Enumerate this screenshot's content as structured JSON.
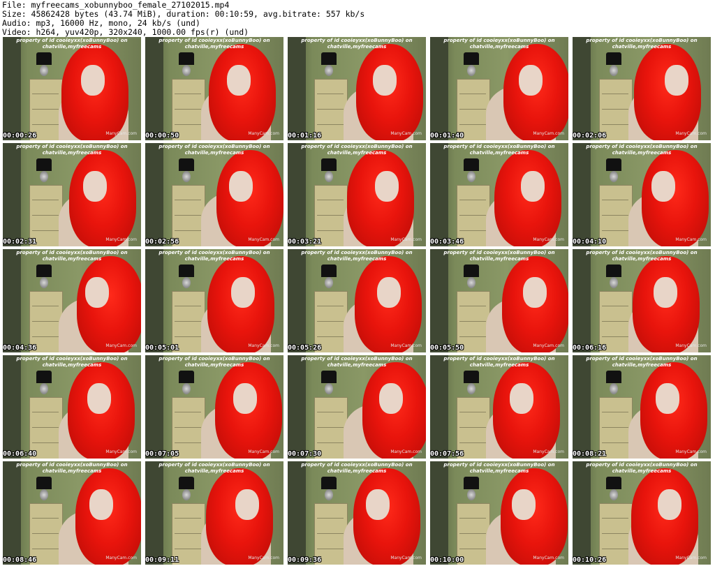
{
  "header": {
    "file": "File: myfreecams_xobunnyboo_female_27102015.mp4",
    "size": "Size: 45862428 bytes (43.74 MiB), duration: 00:10:59, avg.bitrate: 557 kb/s",
    "audio": "Audio: mp3, 16000 Hz, mono, 24 kb/s (und)",
    "video": "Video: h264, yuv420p, 320x240, 1000.00 fps(r) (und)"
  },
  "watermark": {
    "line1": "property of id cooieyxx(xoBunnyBoo) on",
    "line2": "chatville,myfreecams",
    "logo": "ManyCam.com"
  },
  "thumbnails": [
    {
      "time": "00:00:26"
    },
    {
      "time": "00:00:50"
    },
    {
      "time": "00:01:16"
    },
    {
      "time": "00:01:40"
    },
    {
      "time": "00:02:06"
    },
    {
      "time": "00:02:31"
    },
    {
      "time": "00:02:56"
    },
    {
      "time": "00:03:21"
    },
    {
      "time": "00:03:46"
    },
    {
      "time": "00:04:10"
    },
    {
      "time": "00:04:36"
    },
    {
      "time": "00:05:01"
    },
    {
      "time": "00:05:26"
    },
    {
      "time": "00:05:50"
    },
    {
      "time": "00:06:16"
    },
    {
      "time": "00:06:40"
    },
    {
      "time": "00:07:05"
    },
    {
      "time": "00:07:30"
    },
    {
      "time": "00:07:56"
    },
    {
      "time": "00:08:21"
    },
    {
      "time": "00:08:46"
    },
    {
      "time": "00:09:11"
    },
    {
      "time": "00:09:36"
    },
    {
      "time": "00:10:00"
    },
    {
      "time": "00:10:26"
    }
  ],
  "colors": {
    "background": "#ffffff",
    "hair": "#e8140c",
    "wall": "#7d8c5c",
    "timestamp": "#ffffff"
  }
}
